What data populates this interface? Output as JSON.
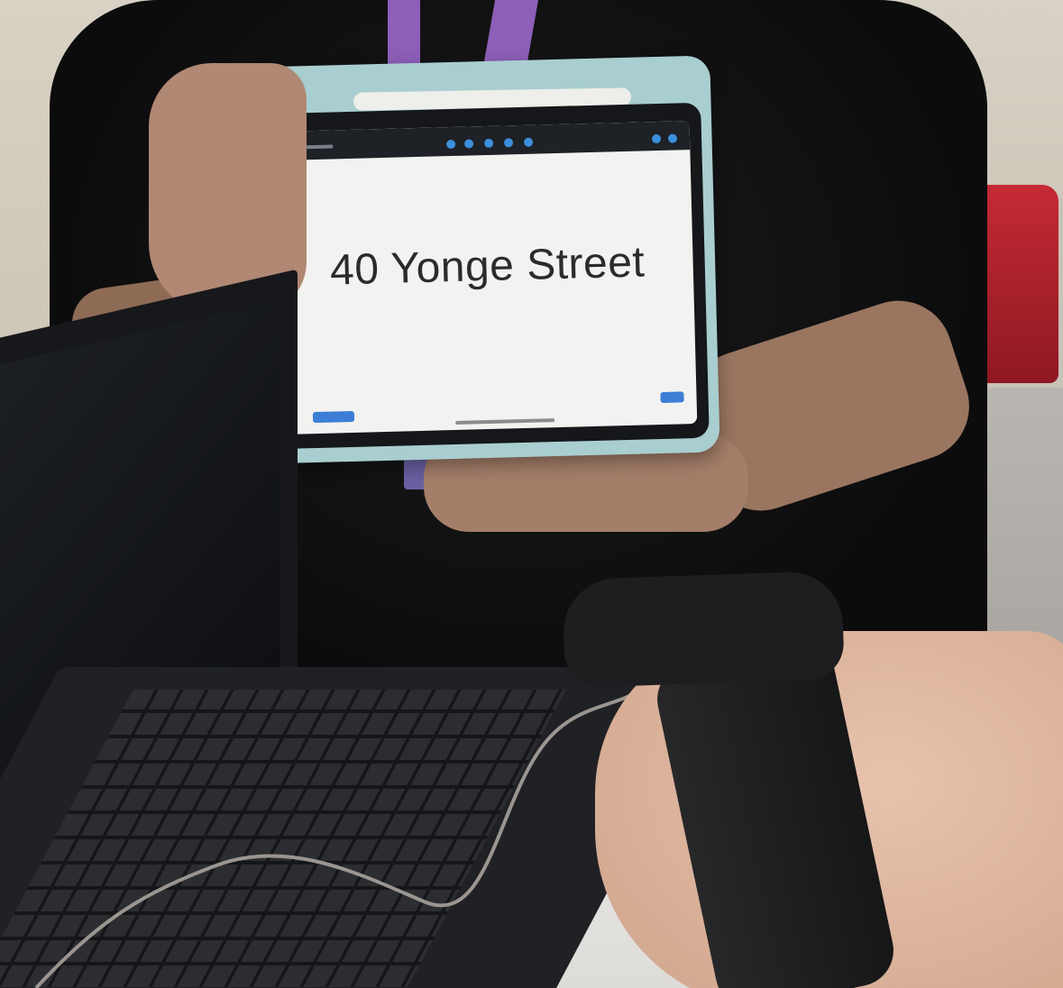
{
  "scene": {
    "tablet": {
      "display_text": "40 Yonge Street"
    }
  }
}
